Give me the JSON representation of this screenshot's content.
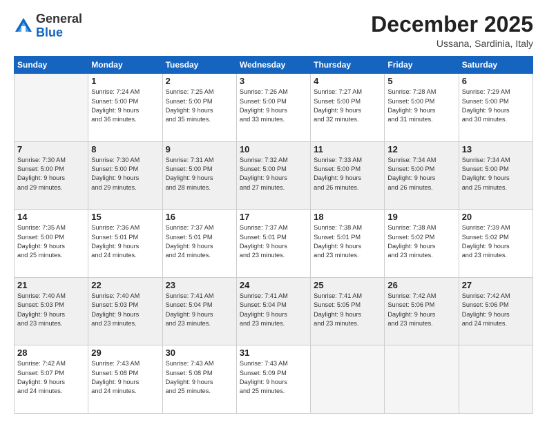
{
  "header": {
    "logo_general": "General",
    "logo_blue": "Blue",
    "month_title": "December 2025",
    "location": "Ussana, Sardinia, Italy"
  },
  "days_of_week": [
    "Sunday",
    "Monday",
    "Tuesday",
    "Wednesday",
    "Thursday",
    "Friday",
    "Saturday"
  ],
  "weeks": [
    [
      {
        "day": "",
        "info": ""
      },
      {
        "day": "1",
        "info": "Sunrise: 7:24 AM\nSunset: 5:00 PM\nDaylight: 9 hours\nand 36 minutes."
      },
      {
        "day": "2",
        "info": "Sunrise: 7:25 AM\nSunset: 5:00 PM\nDaylight: 9 hours\nand 35 minutes."
      },
      {
        "day": "3",
        "info": "Sunrise: 7:26 AM\nSunset: 5:00 PM\nDaylight: 9 hours\nand 33 minutes."
      },
      {
        "day": "4",
        "info": "Sunrise: 7:27 AM\nSunset: 5:00 PM\nDaylight: 9 hours\nand 32 minutes."
      },
      {
        "day": "5",
        "info": "Sunrise: 7:28 AM\nSunset: 5:00 PM\nDaylight: 9 hours\nand 31 minutes."
      },
      {
        "day": "6",
        "info": "Sunrise: 7:29 AM\nSunset: 5:00 PM\nDaylight: 9 hours\nand 30 minutes."
      }
    ],
    [
      {
        "day": "7",
        "info": "Sunrise: 7:30 AM\nSunset: 5:00 PM\nDaylight: 9 hours\nand 29 minutes."
      },
      {
        "day": "8",
        "info": "Sunrise: 7:30 AM\nSunset: 5:00 PM\nDaylight: 9 hours\nand 29 minutes."
      },
      {
        "day": "9",
        "info": "Sunrise: 7:31 AM\nSunset: 5:00 PM\nDaylight: 9 hours\nand 28 minutes."
      },
      {
        "day": "10",
        "info": "Sunrise: 7:32 AM\nSunset: 5:00 PM\nDaylight: 9 hours\nand 27 minutes."
      },
      {
        "day": "11",
        "info": "Sunrise: 7:33 AM\nSunset: 5:00 PM\nDaylight: 9 hours\nand 26 minutes."
      },
      {
        "day": "12",
        "info": "Sunrise: 7:34 AM\nSunset: 5:00 PM\nDaylight: 9 hours\nand 26 minutes."
      },
      {
        "day": "13",
        "info": "Sunrise: 7:34 AM\nSunset: 5:00 PM\nDaylight: 9 hours\nand 25 minutes."
      }
    ],
    [
      {
        "day": "14",
        "info": "Sunrise: 7:35 AM\nSunset: 5:00 PM\nDaylight: 9 hours\nand 25 minutes."
      },
      {
        "day": "15",
        "info": "Sunrise: 7:36 AM\nSunset: 5:01 PM\nDaylight: 9 hours\nand 24 minutes."
      },
      {
        "day": "16",
        "info": "Sunrise: 7:37 AM\nSunset: 5:01 PM\nDaylight: 9 hours\nand 24 minutes."
      },
      {
        "day": "17",
        "info": "Sunrise: 7:37 AM\nSunset: 5:01 PM\nDaylight: 9 hours\nand 23 minutes."
      },
      {
        "day": "18",
        "info": "Sunrise: 7:38 AM\nSunset: 5:01 PM\nDaylight: 9 hours\nand 23 minutes."
      },
      {
        "day": "19",
        "info": "Sunrise: 7:38 AM\nSunset: 5:02 PM\nDaylight: 9 hours\nand 23 minutes."
      },
      {
        "day": "20",
        "info": "Sunrise: 7:39 AM\nSunset: 5:02 PM\nDaylight: 9 hours\nand 23 minutes."
      }
    ],
    [
      {
        "day": "21",
        "info": "Sunrise: 7:40 AM\nSunset: 5:03 PM\nDaylight: 9 hours\nand 23 minutes."
      },
      {
        "day": "22",
        "info": "Sunrise: 7:40 AM\nSunset: 5:03 PM\nDaylight: 9 hours\nand 23 minutes."
      },
      {
        "day": "23",
        "info": "Sunrise: 7:41 AM\nSunset: 5:04 PM\nDaylight: 9 hours\nand 23 minutes."
      },
      {
        "day": "24",
        "info": "Sunrise: 7:41 AM\nSunset: 5:04 PM\nDaylight: 9 hours\nand 23 minutes."
      },
      {
        "day": "25",
        "info": "Sunrise: 7:41 AM\nSunset: 5:05 PM\nDaylight: 9 hours\nand 23 minutes."
      },
      {
        "day": "26",
        "info": "Sunrise: 7:42 AM\nSunset: 5:06 PM\nDaylight: 9 hours\nand 23 minutes."
      },
      {
        "day": "27",
        "info": "Sunrise: 7:42 AM\nSunset: 5:06 PM\nDaylight: 9 hours\nand 24 minutes."
      }
    ],
    [
      {
        "day": "28",
        "info": "Sunrise: 7:42 AM\nSunset: 5:07 PM\nDaylight: 9 hours\nand 24 minutes."
      },
      {
        "day": "29",
        "info": "Sunrise: 7:43 AM\nSunset: 5:08 PM\nDaylight: 9 hours\nand 24 minutes."
      },
      {
        "day": "30",
        "info": "Sunrise: 7:43 AM\nSunset: 5:08 PM\nDaylight: 9 hours\nand 25 minutes."
      },
      {
        "day": "31",
        "info": "Sunrise: 7:43 AM\nSunset: 5:09 PM\nDaylight: 9 hours\nand 25 minutes."
      },
      {
        "day": "",
        "info": ""
      },
      {
        "day": "",
        "info": ""
      },
      {
        "day": "",
        "info": ""
      }
    ]
  ]
}
